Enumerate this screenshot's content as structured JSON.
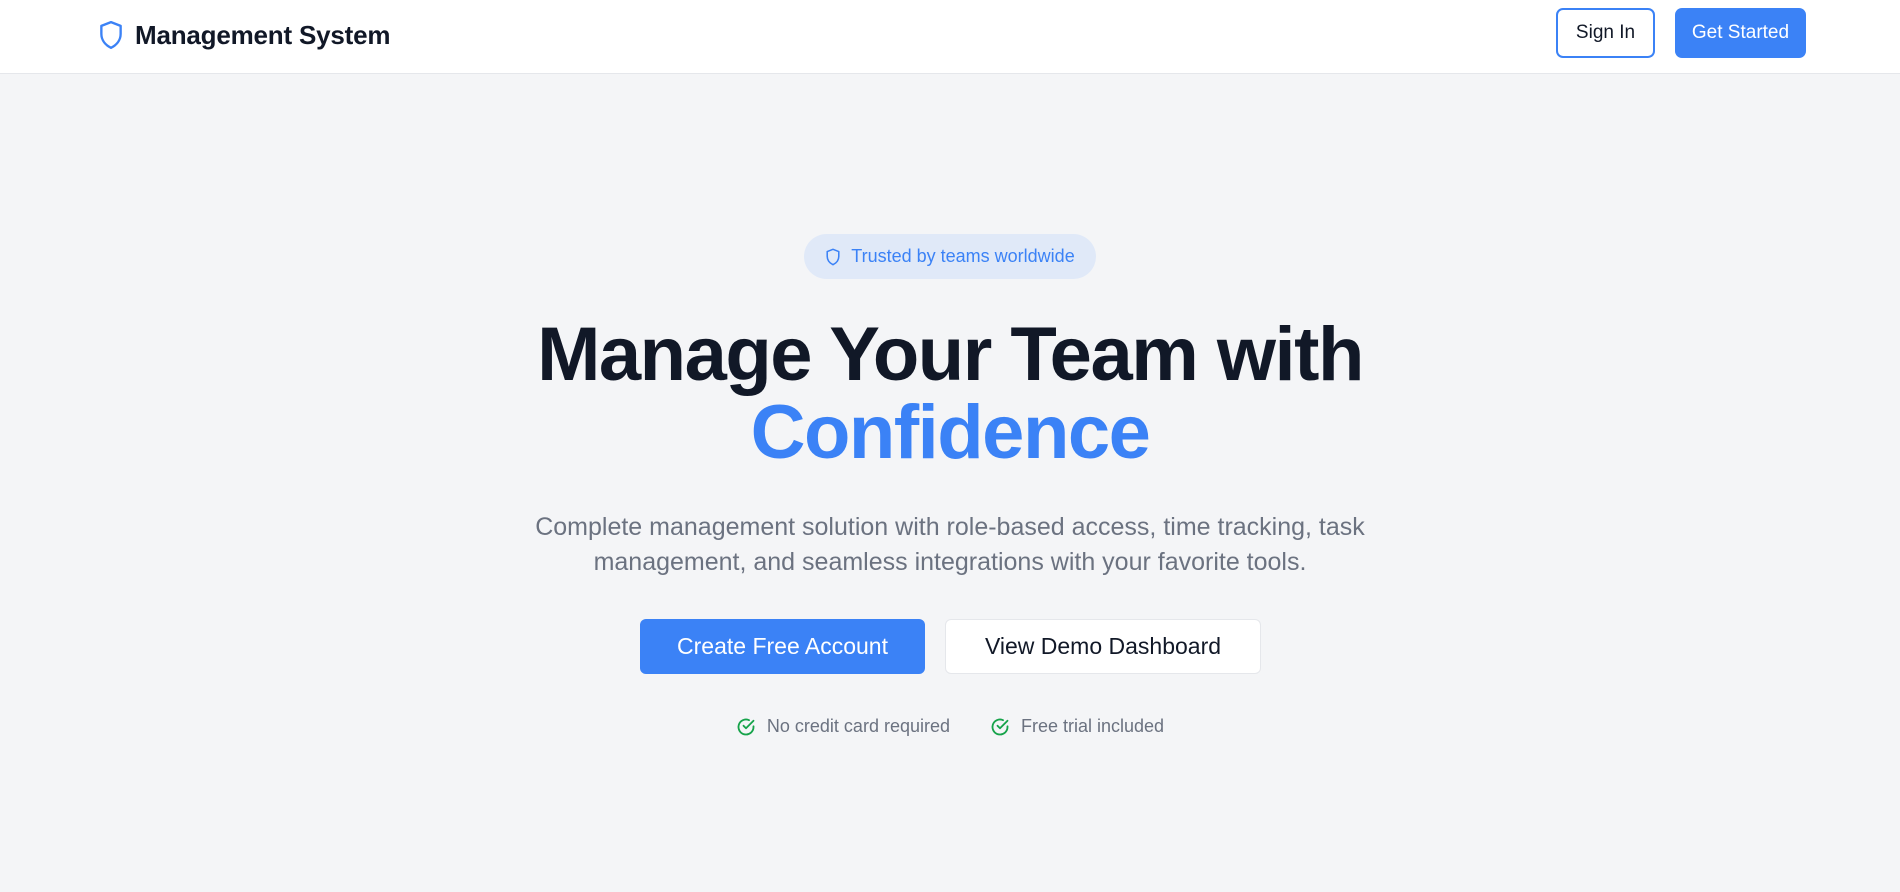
{
  "header": {
    "brand_title": "Management System",
    "sign_in_label": "Sign In",
    "get_started_label": "Get Started"
  },
  "hero": {
    "badge_text": "Trusted by teams worldwide",
    "headline_line1": "Manage Your Team with",
    "headline_accent": "Confidence",
    "subtitle": "Complete management solution with role-based access, time tracking, task management, and seamless integrations with your favorite tools.",
    "primary_cta_label": "Create Free Account",
    "secondary_cta_label": "View Demo Dashboard",
    "perks": [
      {
        "icon": "check-circle-icon",
        "label": "No credit card required"
      },
      {
        "icon": "check-circle-icon",
        "label": "Free trial included"
      }
    ]
  },
  "icons": {
    "brand": "shield-icon",
    "badge": "shield-icon"
  },
  "colors": {
    "accent": "#3b82f6",
    "heading": "#111827",
    "muted_text": "#6b7280",
    "background": "#f4f5f7",
    "badge_background": "#e0e9f8",
    "success": "#16a34a"
  }
}
